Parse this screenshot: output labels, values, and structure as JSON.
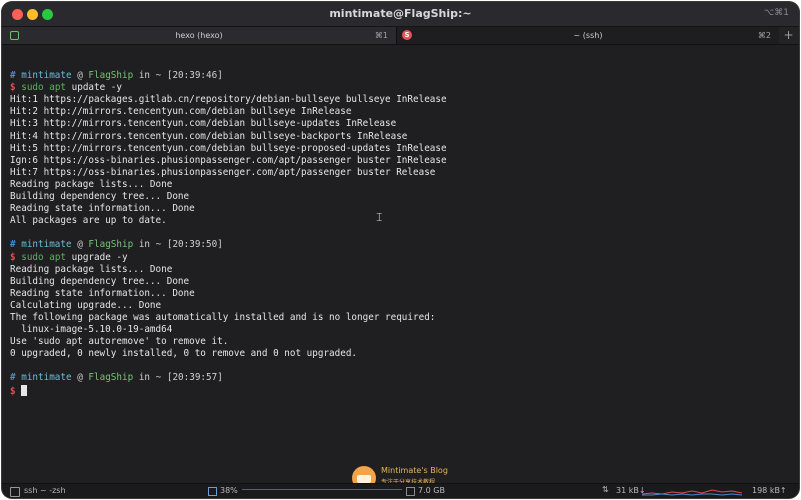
{
  "window": {
    "title": "mintimate@FlagShip:~",
    "hotkey": "⌥⌘1"
  },
  "tabs": [
    {
      "label": "hexo (hexo)",
      "key": "⌘1"
    },
    {
      "label": "~ (ssh)",
      "key": "⌘2",
      "icon_letter": "S"
    }
  ],
  "terminal": {
    "lines": [
      {
        "type": "blank"
      },
      {
        "type": "prompt",
        "user": "mintimate",
        "host": "FlagShip",
        "dir": "~",
        "time": "[20:39:46]"
      },
      {
        "type": "command",
        "cmd": "sudo",
        "cmd2": "apt",
        "args": "update -y"
      },
      {
        "type": "out",
        "text": "Hit:1 https://packages.gitlab.cn/repository/debian-bullseye bullseye InRelease"
      },
      {
        "type": "out",
        "text": "Hit:2 http://mirrors.tencentyun.com/debian bullseye InRelease"
      },
      {
        "type": "out",
        "text": "Hit:3 http://mirrors.tencentyun.com/debian bullseye-updates InRelease"
      },
      {
        "type": "out",
        "text": "Hit:4 http://mirrors.tencentyun.com/debian bullseye-backports InRelease"
      },
      {
        "type": "out",
        "text": "Hit:5 http://mirrors.tencentyun.com/debian bullseye-proposed-updates InRelease"
      },
      {
        "type": "out",
        "text": "Ign:6 https://oss-binaries.phusionpassenger.com/apt/passenger buster InRelease"
      },
      {
        "type": "out",
        "text": "Hit:7 https://oss-binaries.phusionpassenger.com/apt/passenger buster Release"
      },
      {
        "type": "out",
        "text": "Reading package lists... Done"
      },
      {
        "type": "out",
        "text": "Building dependency tree... Done"
      },
      {
        "type": "out",
        "text": "Reading state information... Done"
      },
      {
        "type": "out",
        "text": "All packages are up to date."
      },
      {
        "type": "blank"
      },
      {
        "type": "prompt",
        "user": "mintimate",
        "host": "FlagShip",
        "dir": "~",
        "time": "[20:39:50]"
      },
      {
        "type": "command",
        "cmd": "sudo",
        "cmd2": "apt",
        "args": "upgrade -y"
      },
      {
        "type": "out",
        "text": "Reading package lists... Done"
      },
      {
        "type": "out",
        "text": "Building dependency tree... Done"
      },
      {
        "type": "out",
        "text": "Reading state information... Done"
      },
      {
        "type": "out",
        "text": "Calculating upgrade... Done"
      },
      {
        "type": "out",
        "text": "The following package was automatically installed and is no longer required:"
      },
      {
        "type": "out",
        "text": "  linux-image-5.10.0-19-amd64"
      },
      {
        "type": "out",
        "text": "Use 'sudo apt autoremove' to remove it."
      },
      {
        "type": "out",
        "text": "0 upgraded, 0 newly installed, 0 to remove and 0 not upgraded."
      },
      {
        "type": "blank"
      },
      {
        "type": "prompt",
        "user": "mintimate",
        "host": "FlagShip",
        "dir": "~",
        "time": "[20:39:57]"
      },
      {
        "type": "cursor"
      }
    ],
    "prompt_hash": "#",
    "prompt_at": "@",
    "prompt_in": "in",
    "dollar": "$"
  },
  "watermark": {
    "name": "Mintimate's Blog",
    "subtitle": "专注于分享技术教程"
  },
  "status_bar": {
    "shell": "ssh ~ -zsh",
    "cpu": "38%",
    "memory": "7.0 GB",
    "net_down": "31 kB↓",
    "net_up": "198 kB↑"
  },
  "colors": {
    "background": "#1f1f22",
    "prompt_hash": "#4f88c9",
    "user": "#6bbcd6",
    "host": "#78c37a",
    "dollar": "#e04b53",
    "command": "#5bb35b"
  },
  "icons": {
    "tab1": "terminal-shield-icon",
    "tab2": "ssh-badge-icon",
    "cursor_overlay": "text-ibeam-icon"
  }
}
